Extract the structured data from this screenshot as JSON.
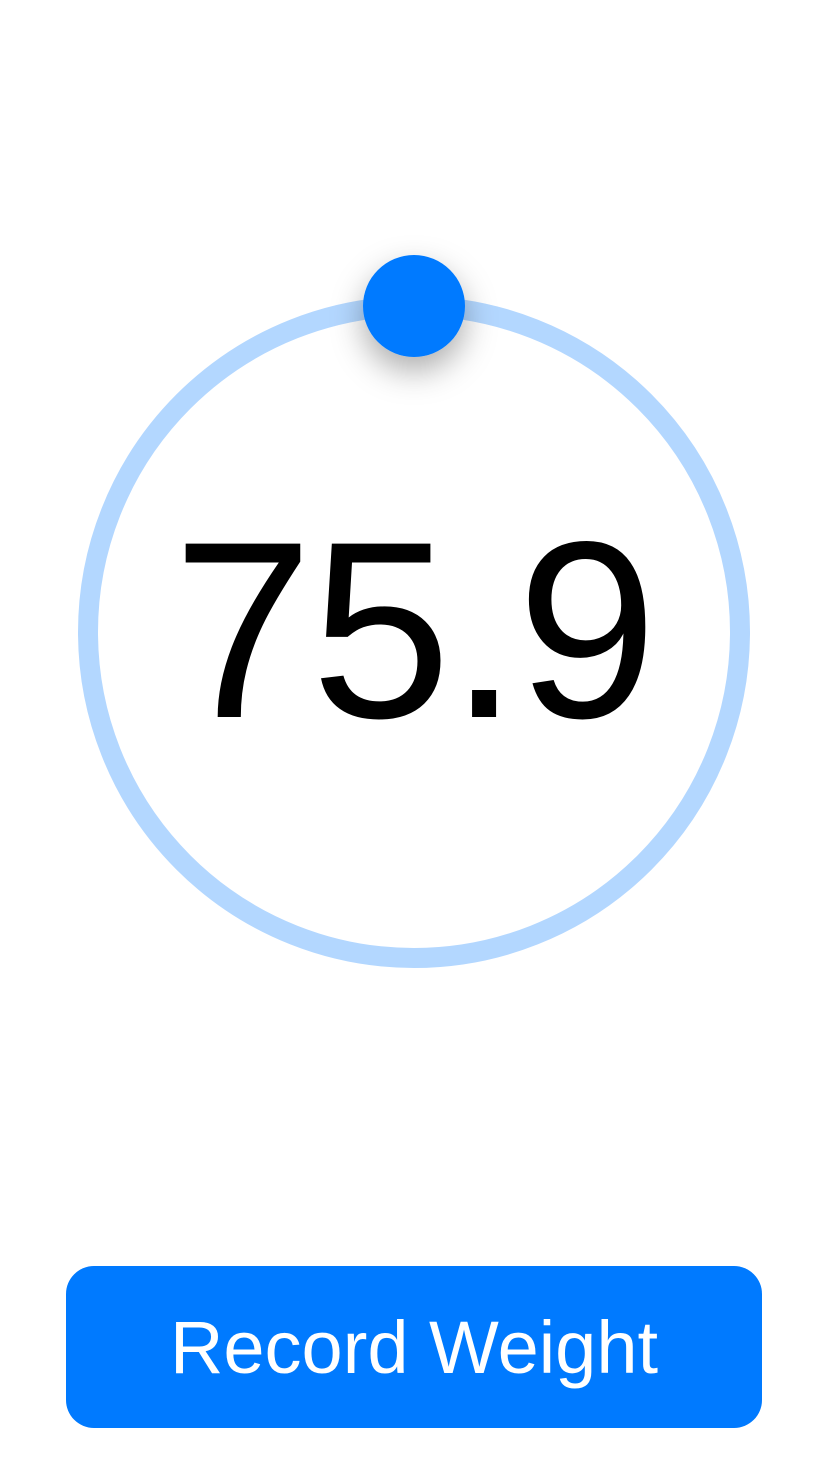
{
  "weight": {
    "value": "75.9",
    "dial_position_fraction": 0.0
  },
  "colors": {
    "accent": "#007aff",
    "track": "#b3d7ff",
    "background": "#ffffff",
    "text": "#000000"
  },
  "actions": {
    "record_label": "Record Weight"
  }
}
